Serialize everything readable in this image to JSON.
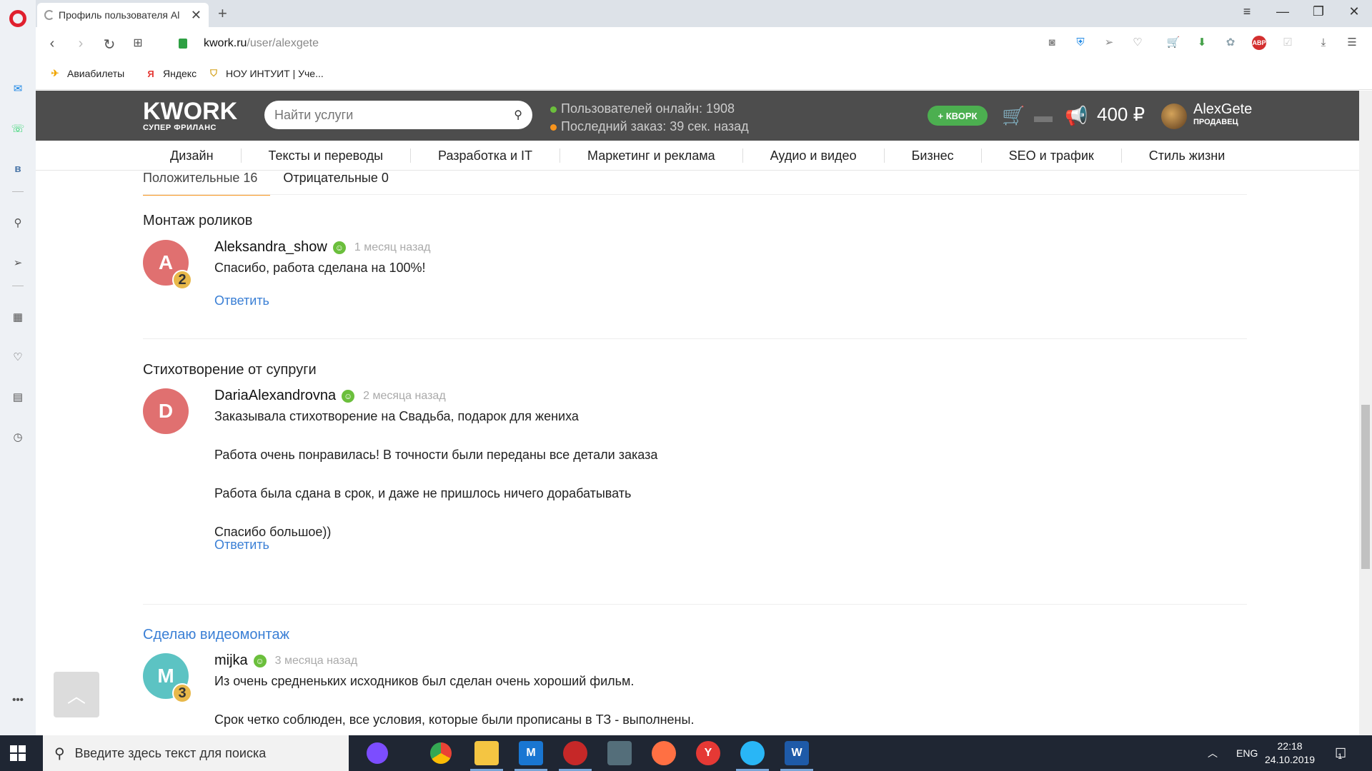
{
  "browser": {
    "tab_title": "Профиль пользователя Al",
    "url_host": "kwork.ru",
    "url_path": "/user/alexgete",
    "bookmarks": [
      "Авиабилеты",
      "Яндекс",
      "НОУ ИНТУИТ | Уче..."
    ]
  },
  "site": {
    "logo": "KWORK",
    "logo_sub": "СУПЕР ФРИЛАНС",
    "search_placeholder": "Найти услуги",
    "online": "Пользователей онлайн: 1908",
    "last_order": "Последний заказ: 39 сек. назад",
    "kwork_button": "КВОРК",
    "balance": "400 ₽",
    "username": "AlexGete",
    "user_role": "ПРОДАВЕЦ",
    "colors": {
      "header_bg": "#4d4d4d",
      "accent_green": "#4caf50",
      "link_blue": "#3a7fd5",
      "tab_underline": "#f7941d"
    }
  },
  "categories": [
    "Дизайн",
    "Тексты и переводы",
    "Разработка и IT",
    "Маркетинг и реклама",
    "Аудио и видео",
    "Бизнес",
    "SEO и трафик",
    "Стиль жизни"
  ],
  "review_tabs": {
    "positive": "Положительные 16",
    "negative": "Отрицательные 0"
  },
  "reviews": [
    {
      "title": "Монтаж роликов",
      "avatar_letter": "A",
      "avatar_color": "#e07070",
      "badge": "2",
      "name": "Aleksandra_show",
      "date": "1 месяц назад",
      "lines": [
        "Спасибо, работа сделана на 100%!"
      ],
      "reply": "Ответить"
    },
    {
      "title": "Стихотворение от супруги",
      "avatar_letter": "D",
      "avatar_color": "#e07070",
      "name": "DariaAlexandrovna",
      "date": "2 месяца назад",
      "lines": [
        "Заказывала стихотворение на Свадьба, подарок для жениха",
        "Работа очень понравилась! В точности были переданы все детали заказа",
        "Работа была сдана в срок, и даже не пришлось ничего дорабатывать",
        "Спасибо большое))"
      ],
      "reply": "Ответить"
    },
    {
      "title": "Сделаю видеомонтаж",
      "avatar_letter": "M",
      "avatar_color": "#5cc3c3",
      "badge": "3",
      "name": "mijka",
      "date": "3 месяца назад",
      "lines": [
        "Из очень средненьких исходников был сделан очень хороший фильм.",
        "Срок четко соблюден, все условия, которые были прописаны в ТЗ - выполнены."
      ]
    }
  ],
  "taskbar": {
    "search_placeholder": "Введите здесь текст для поиска",
    "lang": "ENG",
    "time": "22:18",
    "date": "24.10.2019",
    "notifications": "1"
  }
}
